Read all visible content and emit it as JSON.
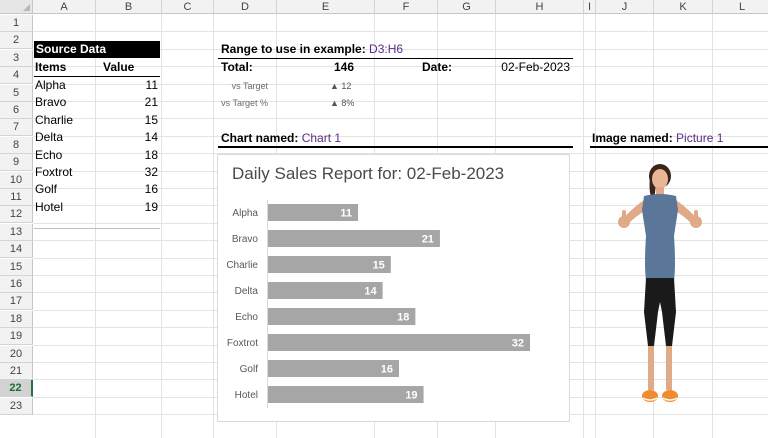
{
  "columns": [
    "A",
    "B",
    "C",
    "D",
    "E",
    "F",
    "G",
    "H",
    "I",
    "J",
    "K",
    "L"
  ],
  "rows": [
    "1",
    "2",
    "3",
    "4",
    "5",
    "6",
    "7",
    "8",
    "9",
    "10",
    "11",
    "12",
    "13",
    "14",
    "15",
    "16",
    "17",
    "18",
    "19",
    "20",
    "21",
    "22",
    "23"
  ],
  "active_row": "22",
  "source": {
    "title": "Source Data",
    "header_items": "Items",
    "header_value": "Value",
    "items": [
      {
        "label": "Alpha",
        "value": "11"
      },
      {
        "label": "Bravo",
        "value": "21"
      },
      {
        "label": "Charlie",
        "value": "15"
      },
      {
        "label": "Delta",
        "value": "14"
      },
      {
        "label": "Echo",
        "value": "18"
      },
      {
        "label": "Foxtrot",
        "value": "32"
      },
      {
        "label": "Golf",
        "value": "16"
      },
      {
        "label": "Hotel",
        "value": "19"
      }
    ]
  },
  "range": {
    "label": "Range to use in example:",
    "value": "D3:H6"
  },
  "summary": {
    "total_label": "Total:",
    "total_value": "146",
    "date_label": "Date:",
    "date_value": "02-Feb-2023",
    "vs_target_label": "vs Target",
    "vs_target_value": "▲ 12",
    "vs_target_pct_label": "vs Target %",
    "vs_target_pct_value": "▲ 8%"
  },
  "chart_label": {
    "label": "Chart named:",
    "value": "Chart 1"
  },
  "image_label": {
    "label": "Image named:",
    "value": "Picture 1"
  },
  "colors": {
    "bar": "#a6a6a6",
    "accent_purple": "#5b2a86",
    "active_row": "#217346"
  },
  "chart_data": {
    "type": "bar",
    "orientation": "horizontal",
    "title": "Daily Sales Report for: 02-Feb-2023",
    "categories": [
      "Alpha",
      "Bravo",
      "Charlie",
      "Delta",
      "Echo",
      "Foxtrot",
      "Golf",
      "Hotel"
    ],
    "values": [
      11,
      21,
      15,
      14,
      18,
      32,
      16,
      19
    ],
    "xlim": [
      0,
      32
    ],
    "grid": false,
    "legend": "none",
    "data_labels": true
  }
}
